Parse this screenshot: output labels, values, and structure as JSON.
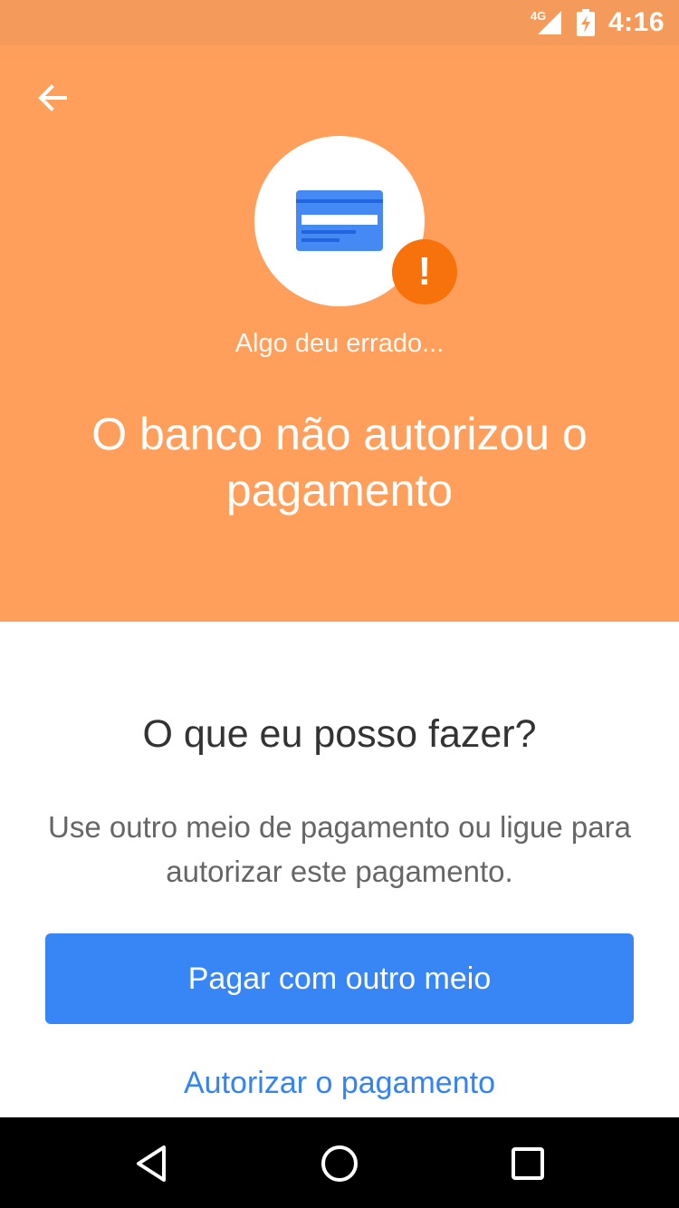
{
  "status_bar": {
    "network": "4G",
    "time": "4:16",
    "signal_icon": "signal-icon",
    "battery_icon": "battery-charging-icon"
  },
  "header": {
    "back_icon": "arrow-back-icon",
    "illustration_icon": "credit-card-icon",
    "alert_icon": "exclamation-icon",
    "alert_symbol": "!",
    "subtitle": "Algo deu errado...",
    "title": "O banco não autorizou o pagamento"
  },
  "content": {
    "question": "O que eu posso fazer?",
    "description": "Use outro meio de pagamento ou ligue para autorizar este pagamento.",
    "primary_button": "Pagar com outro meio",
    "secondary_link": "Autorizar o pagamento"
  },
  "nav_bar": {
    "back_icon": "nav-back-icon",
    "home_icon": "nav-home-icon",
    "recents_icon": "nav-recents-icon"
  },
  "colors": {
    "status_bar": "#f49a5a",
    "hero": "#ff9f5b",
    "alert": "#f8720c",
    "primary": "#3886f5",
    "link": "#3383f2"
  }
}
